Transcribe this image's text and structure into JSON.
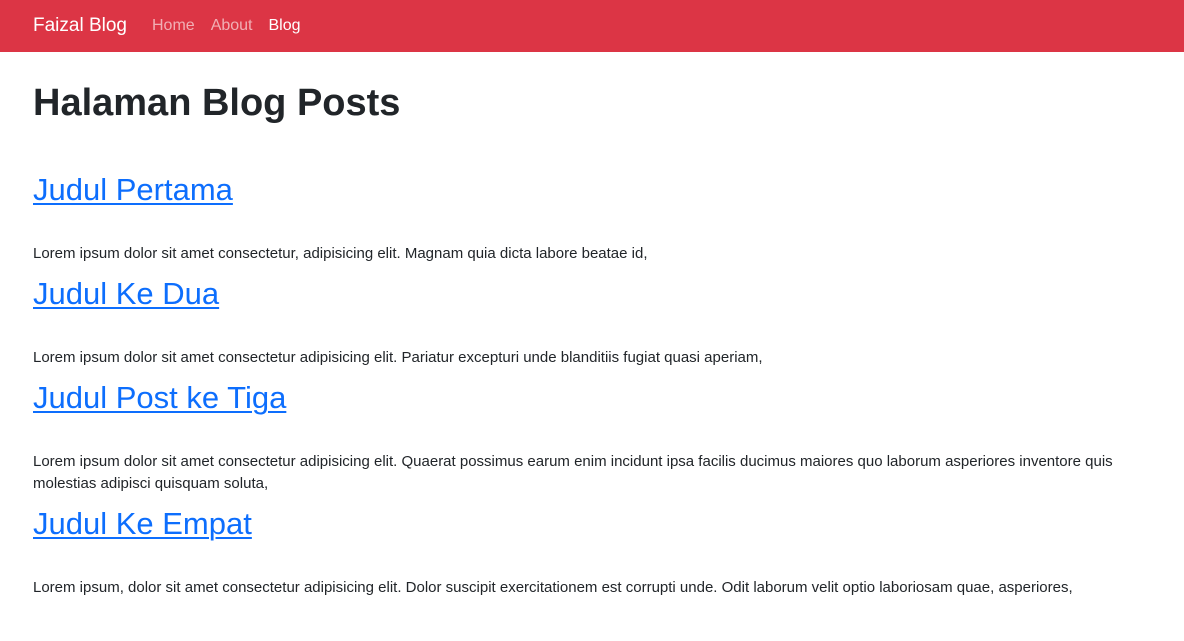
{
  "navbar": {
    "brand": "Faizal Blog",
    "links": [
      {
        "label": "Home",
        "active": false
      },
      {
        "label": "About",
        "active": false
      },
      {
        "label": "Blog",
        "active": true
      }
    ],
    "color": "#dc3545"
  },
  "main": {
    "title": "Halaman Blog Posts",
    "posts": [
      {
        "title": "Judul Pertama",
        "excerpt": "Lorem ipsum dolor sit amet consectetur, adipisicing elit. Magnam quia dicta labore beatae id,"
      },
      {
        "title": "Judul Ke Dua",
        "excerpt": "Lorem ipsum dolor sit amet consectetur adipisicing elit. Pariatur excepturi unde blanditiis fugiat quasi aperiam,"
      },
      {
        "title": "Judul Post ke Tiga",
        "excerpt": "Lorem ipsum dolor sit amet consectetur adipisicing elit. Quaerat possimus earum enim incidunt ipsa facilis ducimus maiores quo laborum asperiores inventore quis molestias adipisci quisquam soluta,"
      },
      {
        "title": "Judul Ke Empat",
        "excerpt": "Lorem ipsum, dolor sit amet consectetur adipisicing elit. Dolor suscipit exercitationem est corrupti unde. Odit laborum velit optio laboriosam quae, asperiores,"
      }
    ],
    "link_color": "#0d6efd"
  }
}
